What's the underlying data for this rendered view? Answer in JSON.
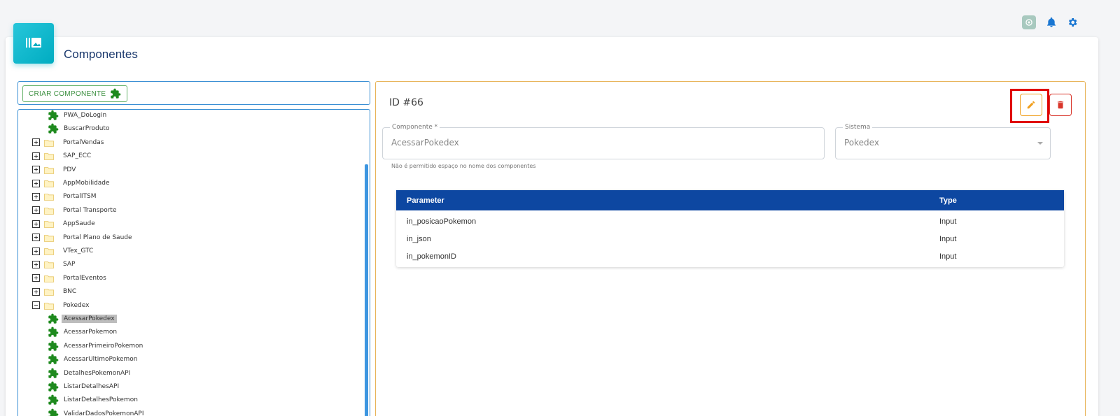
{
  "page": {
    "title": "Componentes"
  },
  "top_icons": [
    "chatgpt-icon",
    "bell-icon",
    "gear-icon"
  ],
  "colors": {
    "accent": "#00acc1",
    "table_header": "#0d47a1",
    "puzzle": "#1e8a1e",
    "edit": "#f0a020",
    "delete": "#d9362b"
  },
  "left": {
    "create_button": "CRIAR COMPONENTE",
    "tree": [
      {
        "type": "item",
        "label": "PWA_DoLogin"
      },
      {
        "type": "item",
        "label": "BuscarProduto"
      },
      {
        "type": "folder",
        "expanded": false,
        "label": "PortalVendas"
      },
      {
        "type": "folder",
        "expanded": false,
        "label": "SAP_ECC"
      },
      {
        "type": "folder",
        "expanded": false,
        "label": "PDV"
      },
      {
        "type": "folder",
        "expanded": false,
        "label": "AppMobilidade"
      },
      {
        "type": "folder",
        "expanded": false,
        "label": "PortalITSM"
      },
      {
        "type": "folder",
        "expanded": false,
        "label": "Portal Transporte"
      },
      {
        "type": "folder",
        "expanded": false,
        "label": "AppSaude"
      },
      {
        "type": "folder",
        "expanded": false,
        "label": "Portal Plano de Saude"
      },
      {
        "type": "folder",
        "expanded": false,
        "label": "VTex_GTC"
      },
      {
        "type": "folder",
        "expanded": false,
        "label": "SAP"
      },
      {
        "type": "folder",
        "expanded": false,
        "label": "PortalEventos"
      },
      {
        "type": "folder",
        "expanded": false,
        "label": "BNC"
      },
      {
        "type": "folder",
        "expanded": true,
        "label": "Pokedex"
      },
      {
        "type": "item",
        "label": "AcessarPokedex",
        "selected": true
      },
      {
        "type": "item",
        "label": "AcessarPokemon"
      },
      {
        "type": "item",
        "label": "AcessarPrimeiroPokemon"
      },
      {
        "type": "item",
        "label": "AcessarUltimoPokemon"
      },
      {
        "type": "item",
        "label": "DetalhesPokemonAPI"
      },
      {
        "type": "item",
        "label": "ListarDetalhesAPI"
      },
      {
        "type": "item",
        "label": "ListarDetalhesPokemon"
      },
      {
        "type": "item",
        "label": "ValidarDadosPokemonAPI"
      }
    ]
  },
  "detail": {
    "id_label": "ID #66",
    "componente": {
      "legend": "Componente *",
      "value": "AcessarPokedex"
    },
    "sistema": {
      "legend": "Sistema",
      "value": "Pokedex"
    },
    "hint": "Não é permitido espaço no nome dos componentes",
    "table": {
      "headers": [
        "Parameter",
        "Type"
      ],
      "rows": [
        [
          "in_posicaoPokemon",
          "Input"
        ],
        [
          "in_json",
          "Input"
        ],
        [
          "in_pokemonID",
          "Input"
        ]
      ]
    }
  }
}
